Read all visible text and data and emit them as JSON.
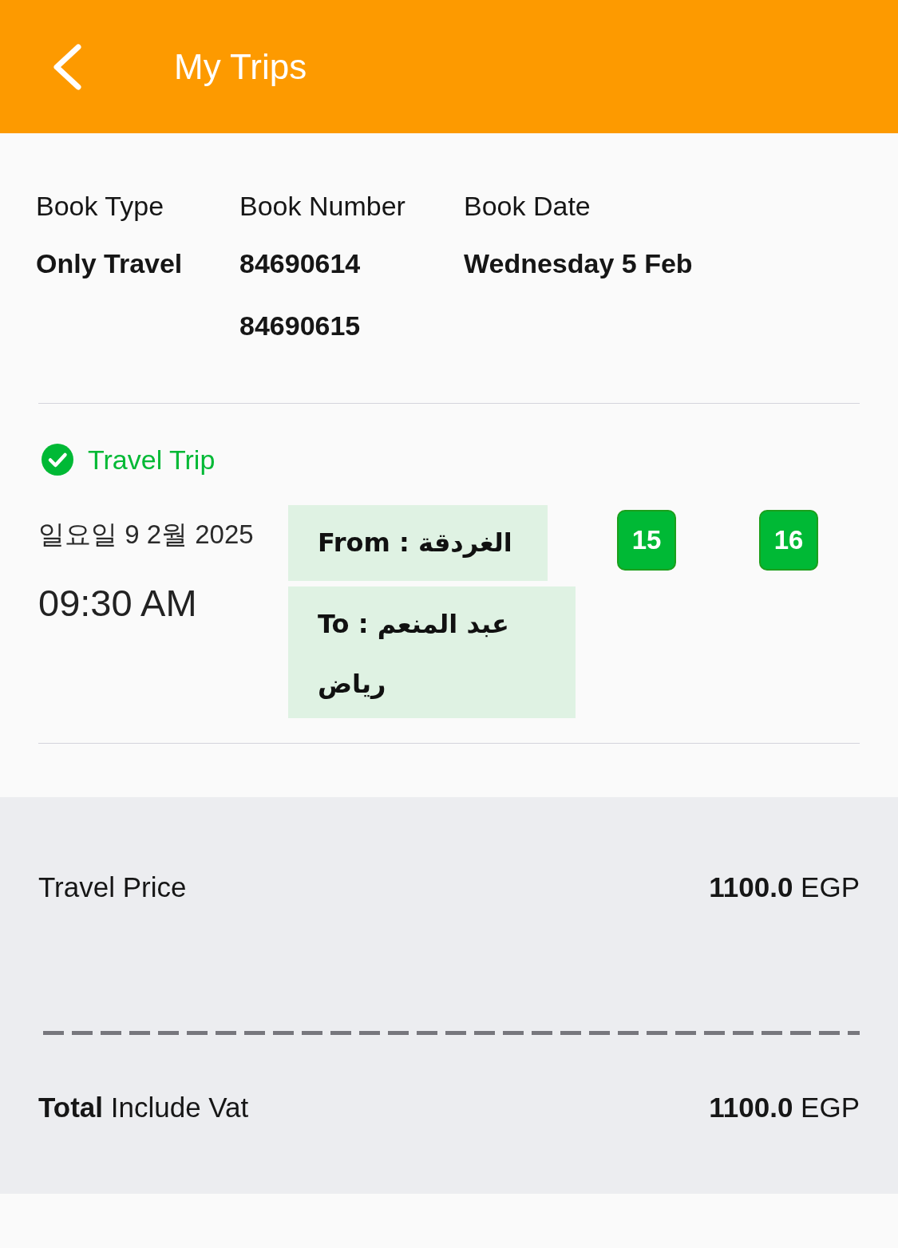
{
  "header": {
    "title": "My Trips"
  },
  "booking": {
    "columns": [
      {
        "label": "Book Type",
        "values": [
          "Only Travel"
        ]
      },
      {
        "label": "Book Number",
        "values": [
          "84690614",
          "84690615"
        ]
      },
      {
        "label": "Book Date",
        "values": [
          "Wednesday 5 Feb"
        ]
      }
    ]
  },
  "trip": {
    "title": "Travel Trip",
    "date": "일요일 9 2월 2025",
    "time": "09:30 AM",
    "from": {
      "label": "From :",
      "place": "الغردقة"
    },
    "to": {
      "label": "To :",
      "place": "عبد المنعم رياض"
    },
    "seats": [
      "15",
      "16"
    ]
  },
  "prices": {
    "lines": [
      {
        "kind": "item",
        "label": "Travel Price",
        "amount": "**1100.0** EGP"
      },
      {
        "kind": "total",
        "label": "**Total** Include Vat",
        "amount": "**1100.0** EGP"
      }
    ]
  }
}
